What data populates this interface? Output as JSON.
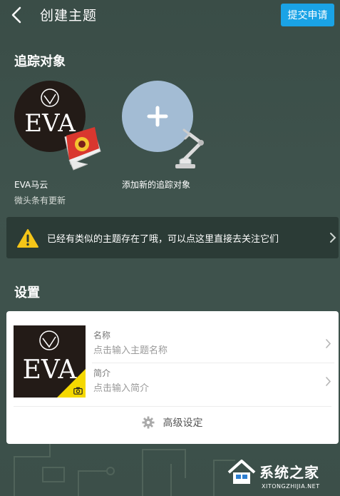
{
  "header": {
    "back_icon": "chevron-left-icon",
    "title": "创建主题",
    "submit_label": "提交申请",
    "submit_color": "#1aa3e6"
  },
  "tracking": {
    "section_title": "追踪对象",
    "target": {
      "logo_text": "EVA",
      "name": "EVA马云",
      "subtitle": "微头条有更新"
    },
    "add": {
      "icon": "plus-icon",
      "label": "添加新的追踪对象"
    }
  },
  "notice": {
    "icon": "warning-icon",
    "text": "已经有类似的主题存在了哦，可以点这里直接去关注它们"
  },
  "settings": {
    "section_title": "设置",
    "cover_logo_text": "EVA",
    "name_field": {
      "label": "名称",
      "placeholder": "点击输入主题名称"
    },
    "intro_field": {
      "label": "简介",
      "placeholder": "点击输入简介"
    },
    "advanced_label": "高级设定"
  },
  "watermark": {
    "text": "系统之家",
    "sub": "XITONGZHIJIA.NET"
  }
}
